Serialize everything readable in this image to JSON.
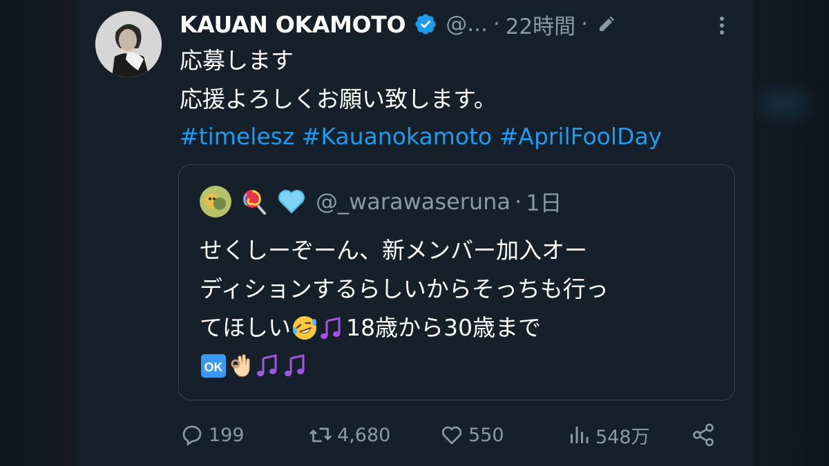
{
  "colors": {
    "background": "#15202b",
    "accent": "#1d9bf0",
    "secondary_text": "#8b98a5",
    "border": "#38444d"
  },
  "tweet": {
    "author_name": "KAUAN OKAMOTO",
    "author_handle": "@...",
    "separator": "·",
    "time": "22時間",
    "verified_icon": "verified-badge-icon",
    "edit_icon": "edit-pencil-icon",
    "more_icon": "more-vertical-icon",
    "body_lines": [
      "応募します",
      "応援よろしくお願い致します。"
    ],
    "hashtags": [
      "#timelesz",
      "#Kauanokamoto",
      "#AprilFoolDay"
    ]
  },
  "quote": {
    "handle": "@_warawaseruna",
    "separator": "·",
    "time": "1日",
    "name_emojis": [
      "lollipop-emoji",
      "light-blue-heart-emoji"
    ],
    "lines": [
      "せくしーぞーん、新メンバー加入オー",
      "ディションするらしいからそっちも行っ",
      "てほしい",
      "18歳から30歳まで"
    ],
    "line3_emojis": [
      "rofl-emoji",
      "music-notes-emoji"
    ],
    "line4_emojis": [
      "ok-button-emoji",
      "ok-hand-emoji",
      "music-notes-emoji",
      "music-notes-emoji"
    ]
  },
  "actions": {
    "replies": "199",
    "retweets": "4,680",
    "likes": "550",
    "views": "548万",
    "reply_icon": "reply-bubble-icon",
    "retweet_icon": "retweet-icon",
    "like_icon": "heart-icon",
    "views_icon": "views-chart-icon",
    "share_icon": "share-icon"
  }
}
